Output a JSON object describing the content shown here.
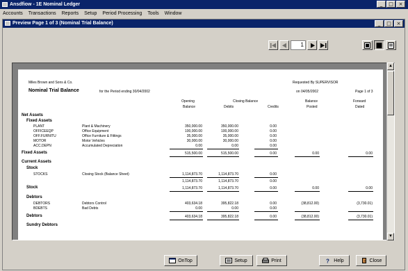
{
  "app": {
    "title": "Ansdfiow - 1E Nominal Ledger",
    "buttons": [
      "_",
      "□",
      "×"
    ]
  },
  "menu": [
    "Accounts",
    "Transactions",
    "Reports",
    "Setup",
    "Period Processing",
    "Tools",
    "Window"
  ],
  "preview": {
    "title": "Preview Page 1 of 3 (Nominal Trial Balance)",
    "page_number": "1"
  },
  "report": {
    "company": "Miles Brown and Sons & Co.",
    "requested_by": "Requested By SUPERVISOR",
    "title": "Nominal Trial Balance",
    "period": "for the Period ending 30/04/2002",
    "run_on": "on 04/05/2002",
    "page": "Page 1 of 3",
    "col_opening_1": "Opening",
    "col_opening_2": "Balance",
    "col_closing_1": "Closing Balance",
    "col_debits": "Debits",
    "col_credits": "Credits",
    "col_balance_1": "Balance",
    "col_balance_2": "Posted",
    "col_forward_1": "Forward",
    "col_forward_2": "Dated",
    "net_assets": "Net Assets",
    "fixed_assets": "Fixed Assets",
    "fixed_rows": [
      {
        "code": "PLANT",
        "desc": "Plant & Machinery",
        "opening": "350,000.00",
        "debits": "350,000.00",
        "credits": "0.00"
      },
      {
        "code": "OFFICEEQP",
        "desc": "Office Equipment",
        "opening": "100,000.00",
        "debits": "100,000.00",
        "credits": "0.00"
      },
      {
        "code": "OFF.FURNITU",
        "desc": "Office Furniture & Fittings",
        "opening": "35,000.00",
        "debits": "35,000.00",
        "credits": "0.00"
      },
      {
        "code": "MOTOR",
        "desc": "Motor Vehicles",
        "opening": "30,000.00",
        "debits": "30,000.00",
        "credits": "0.00"
      },
      {
        "code": "ACC.DEPN",
        "desc": "Accumulated Depreciation",
        "opening": "0.00",
        "debits": "0.00",
        "credits": "0.00"
      }
    ],
    "fixed_total": {
      "label": "Fixed Assets",
      "opening": "515,500.00",
      "debits": "515,500.00",
      "credits": "0.00",
      "posted": "0.00",
      "dated": "0.00"
    },
    "current_assets": "Current Assets",
    "stock": "Stock",
    "stock_row": {
      "code": "STOCKS",
      "desc": "Closing Stock (Balance Sheet)",
      "opening": "1,114,873.70",
      "debits": "1,114,873.70",
      "credits": "0.00"
    },
    "stock_sub": {
      "opening": "1,114,873.70",
      "debits": "1,114,873.70",
      "credits": "0.00"
    },
    "stock_total": {
      "label": "Stock",
      "opening": "1,114,873.70",
      "debits": "1,114,873.70",
      "credits": "0.00",
      "posted": "0.00",
      "dated": "0.00"
    },
    "debtors": "Debtors",
    "debtor_rows": [
      {
        "code": "DEBTORS",
        "desc": "Debtors Control",
        "opening": "403,634.18",
        "debits": "395,822.18",
        "credits": "0.00",
        "posted": "(38,812.00)",
        "dated": "(3,730.01)"
      },
      {
        "code": "BDEBTS",
        "desc": "Bad Debts",
        "opening": "0.00",
        "debits": "0.00",
        "credits": "0.00"
      }
    ],
    "debtors_total": {
      "label": "Debtors",
      "opening": "403,634.18",
      "debits": "395,822.18",
      "credits": "0.00",
      "posted": "(38,812.00)",
      "dated": "(3,730.01)"
    },
    "sundry": "Sundry Debtors"
  },
  "buttons": {
    "ontop": "OnTop",
    "setup": "Setup",
    "print": "Print",
    "help": "Help",
    "close": "Close"
  }
}
